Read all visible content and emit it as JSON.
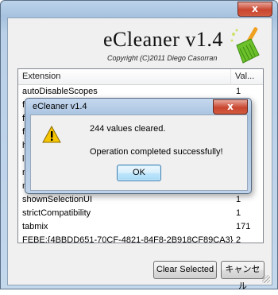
{
  "window": {
    "close_glyph": "x"
  },
  "header": {
    "title": "eCleaner v1.4",
    "copyright": "Copyright (C)2011 Diego Casorran",
    "logo_icon": "broom-icon"
  },
  "list": {
    "columns": [
      "Extension",
      "Val..."
    ],
    "rows": [
      {
        "name": "autoDisableScopes",
        "value": "1"
      },
      {
        "name": "fe",
        "value": ""
      },
      {
        "name": "fir",
        "value": ""
      },
      {
        "name": "fir",
        "value": ""
      },
      {
        "name": "ho",
        "value": ""
      },
      {
        "name": "lo",
        "value": ""
      },
      {
        "name": "m",
        "value": ""
      },
      {
        "name": "m",
        "value": ""
      },
      {
        "name": "shownSelectionUI",
        "value": "1"
      },
      {
        "name": "strictCompatibility",
        "value": "1"
      },
      {
        "name": "tabmix",
        "value": "171"
      },
      {
        "name": "FEBE:{4BBDD651-70CF-4821-84F8-2B918CF89CA3}",
        "value": "2"
      }
    ]
  },
  "buttons": {
    "clear_selected": "Clear Selected",
    "cancel": "キャンセル"
  },
  "dialog": {
    "title": "eCleaner v1.4",
    "close_glyph": "x",
    "icon": "warning-icon",
    "message_1": "244 values cleared.",
    "message_2": "Operation completed successfully!",
    "ok_label": "OK"
  },
  "colors": {
    "frame": "#a7c2df",
    "client": "#f0f0f0",
    "close_button": "#c9462f",
    "warning": "#f5c500"
  }
}
